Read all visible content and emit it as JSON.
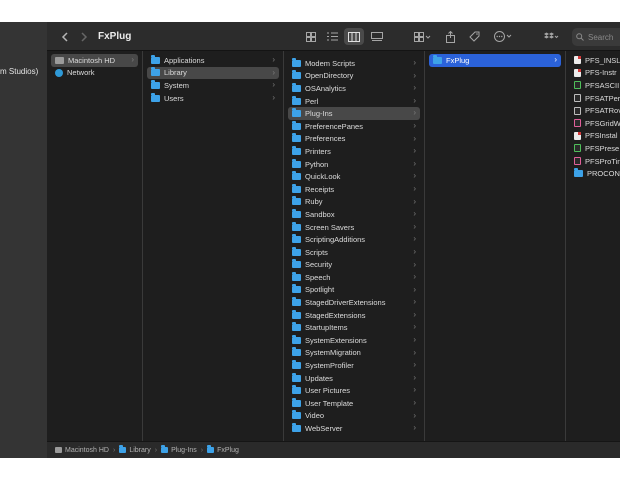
{
  "window": {
    "title": "FxPlug",
    "left_sidebar_text": "m Studios)",
    "search_placeholder": "Search"
  },
  "col1": [
    {
      "label": "Macintosh HD",
      "icon": "disk-icon",
      "selected": "grey"
    },
    {
      "label": "Network",
      "icon": "globe-icon"
    }
  ],
  "col2": [
    {
      "label": "Applications"
    },
    {
      "label": "Library",
      "selected": "grey"
    },
    {
      "label": "System"
    },
    {
      "label": "Users"
    }
  ],
  "col3": [
    "Modem Scripts",
    "OpenDirectory",
    "OSAnalytics",
    "Perl",
    "Plug-Ins",
    "PreferencePanes",
    "Preferences",
    "Printers",
    "Python",
    "QuickLook",
    "Receipts",
    "Ruby",
    "Sandbox",
    "Screen Savers",
    "ScriptingAdditions",
    "Scripts",
    "Security",
    "Speech",
    "Spotlight",
    "StagedDriverExtensions",
    "StagedExtensions",
    "StartupItems",
    "SystemExtensions",
    "SystemMigration",
    "SystemProfiler",
    "Updates",
    "User Pictures",
    "User Template",
    "Video",
    "WebServer"
  ],
  "col3_selected_index": 4,
  "col4": [
    {
      "label": "FxPlug",
      "selected": "blue"
    }
  ],
  "col5": [
    {
      "label": "PFS_INSL",
      "icon": "doc-red"
    },
    {
      "label": "PFS-Instr",
      "icon": "doc-red"
    },
    {
      "label": "PFSASCII",
      "icon": "doc-green"
    },
    {
      "label": "PFSATPer",
      "icon": "doc-dark"
    },
    {
      "label": "PFSATRov",
      "icon": "doc-dark"
    },
    {
      "label": "PFSGridW",
      "icon": "doc-pink"
    },
    {
      "label": "PFSInstal",
      "icon": "doc-red"
    },
    {
      "label": "PFSPrese",
      "icon": "doc-green"
    },
    {
      "label": "PFSProTin",
      "icon": "doc-pink"
    },
    {
      "label": "PROCONN",
      "icon": "folder"
    }
  ],
  "pathbar": [
    "Macintosh HD",
    "Library",
    "Plug-Ins",
    "FxPlug"
  ],
  "colors": {
    "selection_blue": "#2b62d9",
    "folder_blue": "#3da2e8",
    "window_bg": "#1e1e1e"
  }
}
